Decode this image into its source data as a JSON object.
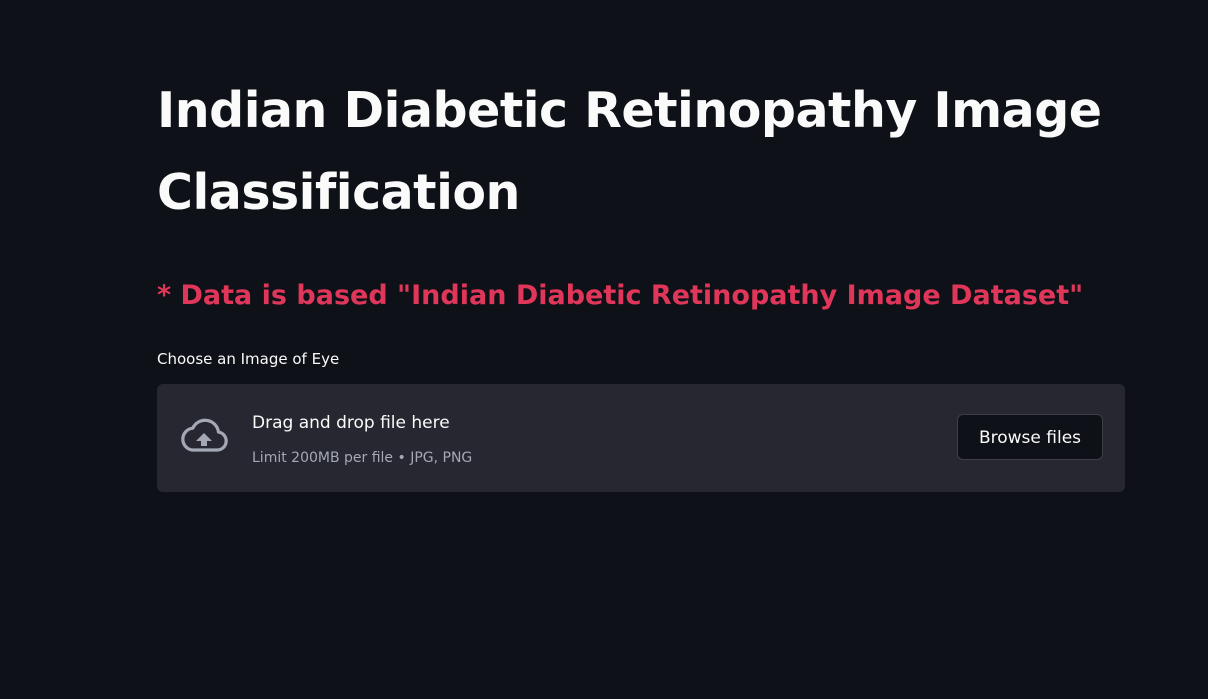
{
  "page": {
    "title": "Indian Diabetic Retinopathy Image Classification",
    "subtitle": "* Data is based \"Indian Diabetic Retinopathy Image Dataset\""
  },
  "uploader": {
    "label": "Choose an Image of Eye",
    "drop_text": "Drag and drop file here",
    "limit_text": "Limit 200MB per file • JPG, PNG",
    "browse_label": "Browse files",
    "icon": "cloud-upload-icon"
  },
  "colors": {
    "background": "#0e1117",
    "text": "#fafafa",
    "accent_red": "#e0365a",
    "dropzone": "#262730",
    "muted": "#a3a8b4"
  }
}
